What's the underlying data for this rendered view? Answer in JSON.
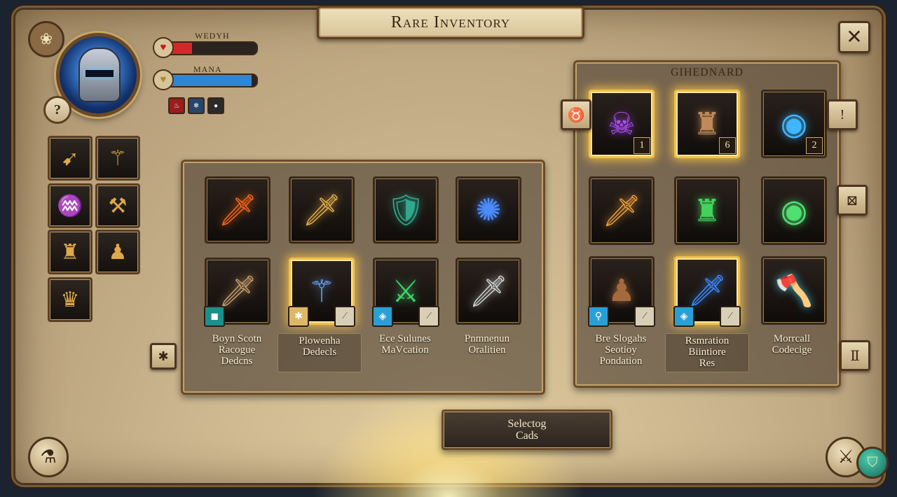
{
  "header": {
    "title": "Rare Inventory",
    "close_label": "✕"
  },
  "player": {
    "help_label": "?",
    "emblem": "❀",
    "health": {
      "label": "WEDYH",
      "value": 0.3,
      "color": "#d7262a",
      "icon": "heart-icon",
      "glyph": "♥"
    },
    "mana": {
      "label": "MANA",
      "value": 0.95,
      "color": "#2f86d4",
      "icon": "heart-icon",
      "glyph": "♥"
    },
    "buffs": [
      {
        "icon": "flame-buff-icon",
        "glyph": "♨",
        "color": "#9b1c1c"
      },
      {
        "icon": "frost-buff-icon",
        "glyph": "❄",
        "color": "#27456b"
      },
      {
        "icon": "shadow-buff-icon",
        "glyph": "●",
        "color": "#2a2a2a"
      }
    ]
  },
  "sidebar": {
    "slots": [
      {
        "icon": "spear-icon",
        "glyph": "➹"
      },
      {
        "icon": "staff-pair-icon",
        "glyph": "⚚"
      },
      {
        "icon": "scroll-icon",
        "glyph": "♒"
      },
      {
        "icon": "anvil-icon",
        "glyph": "⚒"
      },
      {
        "icon": "goblet-icon",
        "glyph": "♜"
      },
      {
        "icon": "boots-icon",
        "glyph": "♟"
      },
      {
        "icon": "crown-helmet-icon",
        "glyph": "♛"
      }
    ]
  },
  "main_panel": {
    "rows": [
      [
        {
          "icon": "flaming-sword-icon",
          "glyph": "🗡",
          "color": "#ff6a1a",
          "selected": false
        },
        {
          "icon": "golden-sword-icon",
          "glyph": "🗡",
          "color": "#e8b34a",
          "selected": false
        },
        {
          "icon": "teal-shield-icon",
          "glyph": "🛡",
          "color": "#2fa98d",
          "selected": false
        },
        {
          "icon": "arcane-orb-icon",
          "glyph": "✺",
          "color": "#4a8cff",
          "selected": false
        }
      ],
      [
        {
          "icon": "broadsword-icon",
          "glyph": "🗡",
          "color": "#caa06e",
          "selected": false,
          "tag": {
            "icon": "rune-tag-icon",
            "glyph": "◼",
            "color": "#1d8f8a"
          }
        },
        {
          "icon": "magic-staff-icon",
          "glyph": "⚚",
          "color": "#6ba8ff",
          "selected": true,
          "tag": {
            "icon": "star-tag-icon",
            "glyph": "✱",
            "color": "#ddb866"
          },
          "tag2": {
            "icon": "slash-tag-icon",
            "glyph": "⁄",
            "color": "#3b3b3b"
          }
        },
        {
          "icon": "crossed-swords-icon",
          "glyph": "⚔",
          "color": "#3fd06a",
          "selected": false,
          "tag": {
            "icon": "gem-tag-icon",
            "glyph": "◈",
            "color": "#2a9fd6"
          },
          "tag2": {
            "icon": "slash-tag-icon",
            "glyph": "⁄",
            "color": "#3b3b3b"
          }
        },
        {
          "icon": "dagger-icon",
          "glyph": "🗡",
          "color": "#d6d6d6",
          "selected": false
        }
      ]
    ],
    "captions": [
      {
        "lines": "Boyn Scotn\nRacogue\nDedcns",
        "boxed": false
      },
      {
        "lines": "Plowenha\nDedecls",
        "boxed": true
      },
      {
        "lines": "Ece Sulunes\nMaVcation",
        "boxed": false
      },
      {
        "lines": "Pnmnenun\nOralitien",
        "boxed": false
      }
    ],
    "prev_button": "✱"
  },
  "right_panel": {
    "title": "GIHEDNARD",
    "rows": [
      [
        {
          "icon": "purple-skull-helm-icon",
          "glyph": "☠",
          "color": "#b24dff",
          "selected": true,
          "count": "1"
        },
        {
          "icon": "plate-armor-icon",
          "glyph": "♜",
          "color": "#c08a5a",
          "selected": true,
          "count": "6"
        },
        {
          "icon": "spectral-helm-icon",
          "glyph": "◉",
          "color": "#3fb6ff",
          "selected": false,
          "count": "2"
        }
      ],
      [
        {
          "icon": "fire-sword-icon",
          "glyph": "🗡",
          "color": "#f0a040",
          "selected": false
        },
        {
          "icon": "green-helm-icon",
          "glyph": "♜",
          "color": "#43d25a",
          "selected": false
        },
        {
          "icon": "green-spirit-helm-icon",
          "glyph": "◉",
          "color": "#4fe070",
          "selected": false
        }
      ],
      [
        {
          "icon": "leather-hood-icon",
          "glyph": "♟",
          "color": "#a56a3c",
          "selected": false,
          "tag": {
            "icon": "key-tag-icon",
            "glyph": "⚲",
            "color": "#2a9fd6"
          },
          "tag2": {
            "icon": "slash-tag-icon",
            "glyph": "⁄",
            "color": "#3b3b3b"
          }
        },
        {
          "icon": "blue-blade-icon",
          "glyph": "🗡",
          "color": "#3f8cff",
          "selected": true,
          "tag": {
            "icon": "gem-tag-icon",
            "glyph": "◈",
            "color": "#2a9fd6"
          },
          "tag2": {
            "icon": "slash-tag-icon",
            "glyph": "⁄",
            "color": "#3b3b3b"
          }
        },
        {
          "icon": "battle-axe-icon",
          "glyph": "🪓",
          "color": "#3fb0c0",
          "selected": false
        }
      ]
    ],
    "captions": [
      {
        "lines": "Bre Slogahs\nSeotioy\nPondation",
        "boxed": false
      },
      {
        "lines": "Rsmration\nBiintiore\nRes",
        "boxed": true
      },
      {
        "lines": "Morrcall\nCodecige",
        "boxed": false
      }
    ],
    "left_button": "♉",
    "right_buttons": [
      "!",
      "⊠",
      "Ⅱ"
    ]
  },
  "footer": {
    "select_label": "Selectog\nCads",
    "potion_glyph": "⚗",
    "swords_glyph": "⚔",
    "shield_glyph": "⛉"
  }
}
